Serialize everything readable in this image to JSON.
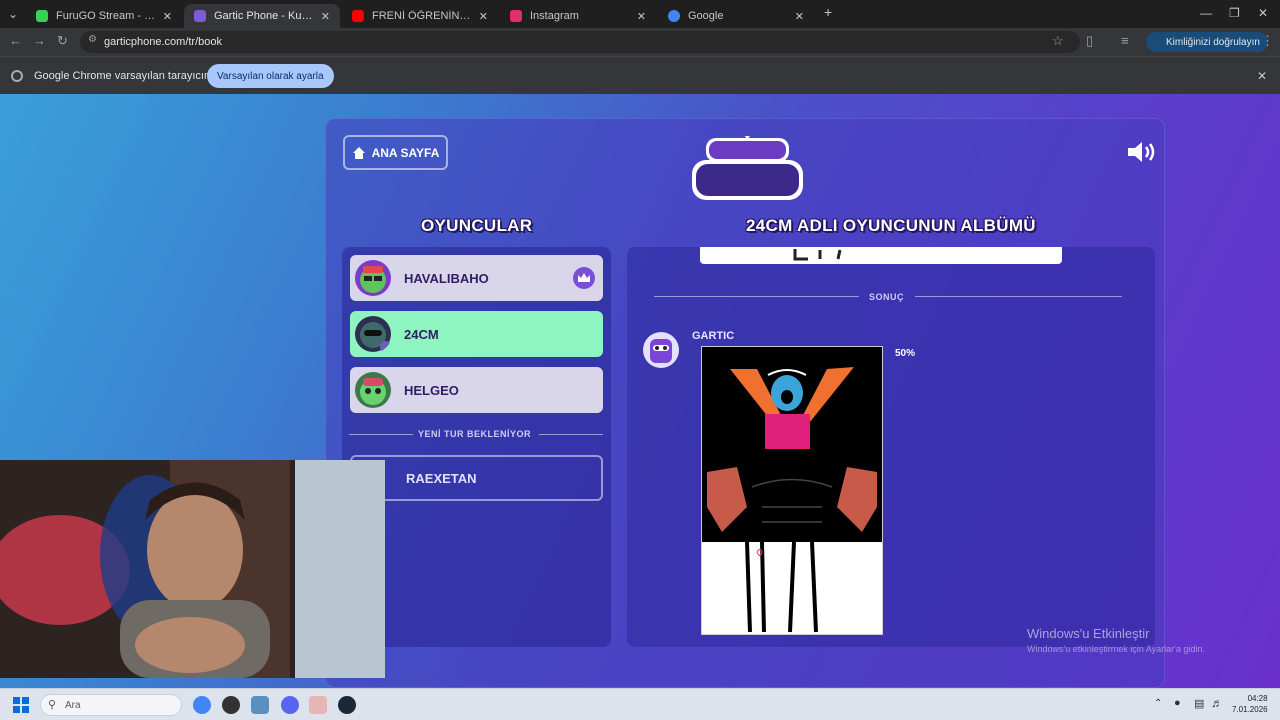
{
  "browser": {
    "tabs": [
      {
        "title": "FuruGO Stream - Watch Live o",
        "color": "#39d353"
      },
      {
        "title": "Gartic Phone - Kulaktan Kulağa",
        "color": "#7b5cd6"
      },
      {
        "title": "FRENİ ÖĞRENİN | SSriders | Mo",
        "color": "#ff0000"
      },
      {
        "title": "Instagram",
        "color": "#e1306c"
      },
      {
        "title": "Google",
        "color": "#4285f4"
      }
    ],
    "url": "garticphone.com/tr/book",
    "verify_label": "Kimliğinizi doğrulayın",
    "infobar_text": "Google Chrome varsayılan tarayıcınız değil",
    "infobar_button": "Varsayılan olarak ayarla"
  },
  "game": {
    "home_label": "ANA SAYFA",
    "players_heading": "OYUNCULAR",
    "album_heading": "24CM ADLI OYUNCUNUN ALBÜMÜ",
    "players": [
      {
        "name": "HAVALIBAHO"
      },
      {
        "name": "24CM"
      },
      {
        "name": "HELGEO"
      }
    ],
    "waiting_label": "YENİ TUR BEKLENİYOR",
    "waiting_player": "RAEXETAN",
    "result_label": "SONUÇ",
    "result_author": "GARTIC",
    "result_percent": "50%"
  },
  "os": {
    "watermark_title": "Windows'u Etkinleştir",
    "watermark_sub": "Windows'u etkinleştirmek için Ayarlar'a gidin.",
    "search_placeholder": "Ara",
    "time": "04:28",
    "date": "7.01.2026"
  }
}
